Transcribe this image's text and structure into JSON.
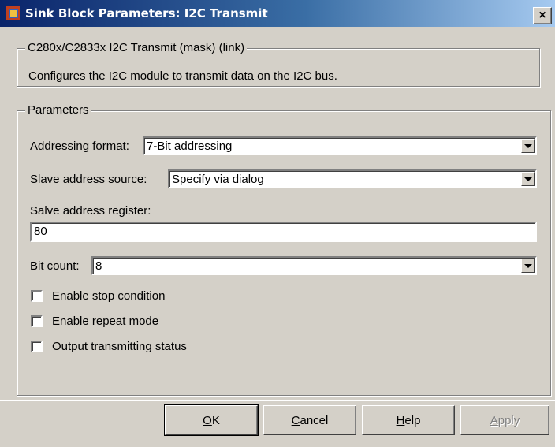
{
  "window": {
    "title": "Sink Block Parameters: I2C Transmit",
    "close_label": "×"
  },
  "mask": {
    "group_label": "C280x/C2833x I2C Transmit (mask) (link)",
    "description": "Configures the I2C module to transmit data on the I2C bus."
  },
  "parameters": {
    "group_label": "Parameters",
    "addressing_format": {
      "label": "Addressing format:",
      "value": "7-Bit addressing"
    },
    "slave_address_source": {
      "label": "Slave address source:",
      "value": "Specify via dialog"
    },
    "slave_address_register": {
      "label": "Salve address register:",
      "value": "80"
    },
    "bit_count": {
      "label": "Bit count:",
      "value": "8"
    },
    "checkboxes": [
      {
        "label": "Enable stop condition",
        "checked": false
      },
      {
        "label": "Enable repeat mode",
        "checked": false
      },
      {
        "label": "Output transmitting status",
        "checked": false
      }
    ]
  },
  "buttons": {
    "ok": {
      "pre": "",
      "mnemonic": "O",
      "post": "K"
    },
    "cancel": {
      "pre": "",
      "mnemonic": "C",
      "post": "ancel"
    },
    "help": {
      "pre": "",
      "mnemonic": "H",
      "post": "elp"
    },
    "apply": {
      "pre": "",
      "mnemonic": "A",
      "post": "pply",
      "enabled": false
    }
  }
}
